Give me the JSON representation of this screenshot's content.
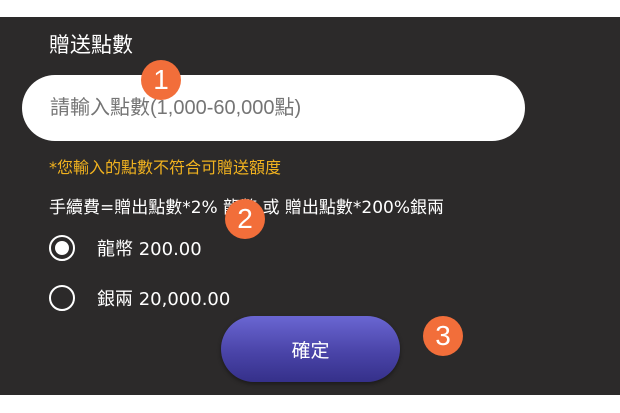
{
  "panel": {
    "title": "贈送點數",
    "input": {
      "value": "",
      "placeholder": "請輸入點數(1,000-60,000點)"
    },
    "warning": "*您輸入的點數不符合可贈送額度",
    "fee_note": "手續費=贈出點數*2% 龍幣 或 贈出點數*200%銀兩",
    "options": [
      {
        "label": "龍幣 200.00",
        "selected": true
      },
      {
        "label": "銀兩 20,000.00",
        "selected": false
      }
    ],
    "confirm_label": "確定"
  },
  "markers": [
    "1",
    "2",
    "3"
  ],
  "colors": {
    "panel_bg": "#2c2a2a",
    "warning": "#f1b21f",
    "button": "#4a44a8",
    "marker": "#f26e3a"
  }
}
